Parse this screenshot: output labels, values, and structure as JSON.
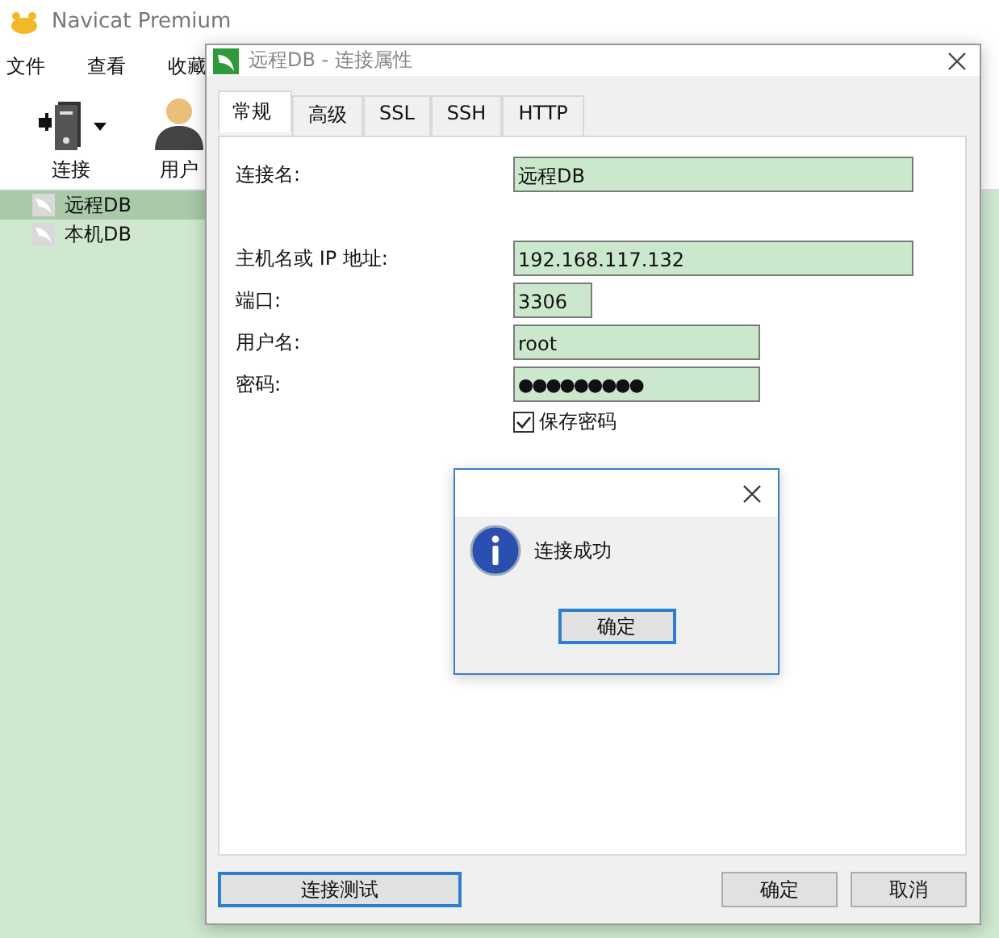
{
  "app": {
    "title": "Navicat Premium",
    "menu": [
      "文件",
      "查看",
      "收藏"
    ],
    "toolbar": [
      {
        "kind": "connection",
        "label": "连接",
        "dropdown": true
      },
      {
        "kind": "user",
        "label": "用户",
        "dropdown": false
      }
    ],
    "sidebar": {
      "items": [
        {
          "label": "远程DB",
          "selected": true
        },
        {
          "label": "本机DB",
          "selected": false
        }
      ]
    }
  },
  "dialog": {
    "title": "远程DB - 连接属性",
    "tabs": [
      {
        "label": "常规",
        "selected": true
      },
      {
        "label": "高级",
        "selected": false
      },
      {
        "label": "SSL",
        "selected": false
      },
      {
        "label": "SSH",
        "selected": false
      },
      {
        "label": "HTTP",
        "selected": false
      }
    ],
    "fields": [
      {
        "kind": "name",
        "label": "连接名:",
        "value": "远程DB"
      },
      {
        "kind": "host",
        "label": "主机名或 IP 地址:",
        "value": "192.168.117.132"
      },
      {
        "kind": "port",
        "label": "端口:",
        "value": "3306"
      },
      {
        "kind": "user",
        "label": "用户名:",
        "value": "root"
      },
      {
        "kind": "password",
        "label": "密码:",
        "value": "●●●●●●●●●"
      }
    ],
    "save_password": {
      "label": "保存密码",
      "checked": true
    },
    "buttons": [
      {
        "kind": "test",
        "label": "连接测试",
        "focused": true
      },
      {
        "kind": "ok",
        "label": "确定",
        "focused": false
      },
      {
        "kind": "cancel",
        "label": "取消",
        "focused": false
      }
    ]
  },
  "message_box": {
    "text": "连接成功",
    "button": {
      "label": "确定",
      "focused": true
    }
  }
}
